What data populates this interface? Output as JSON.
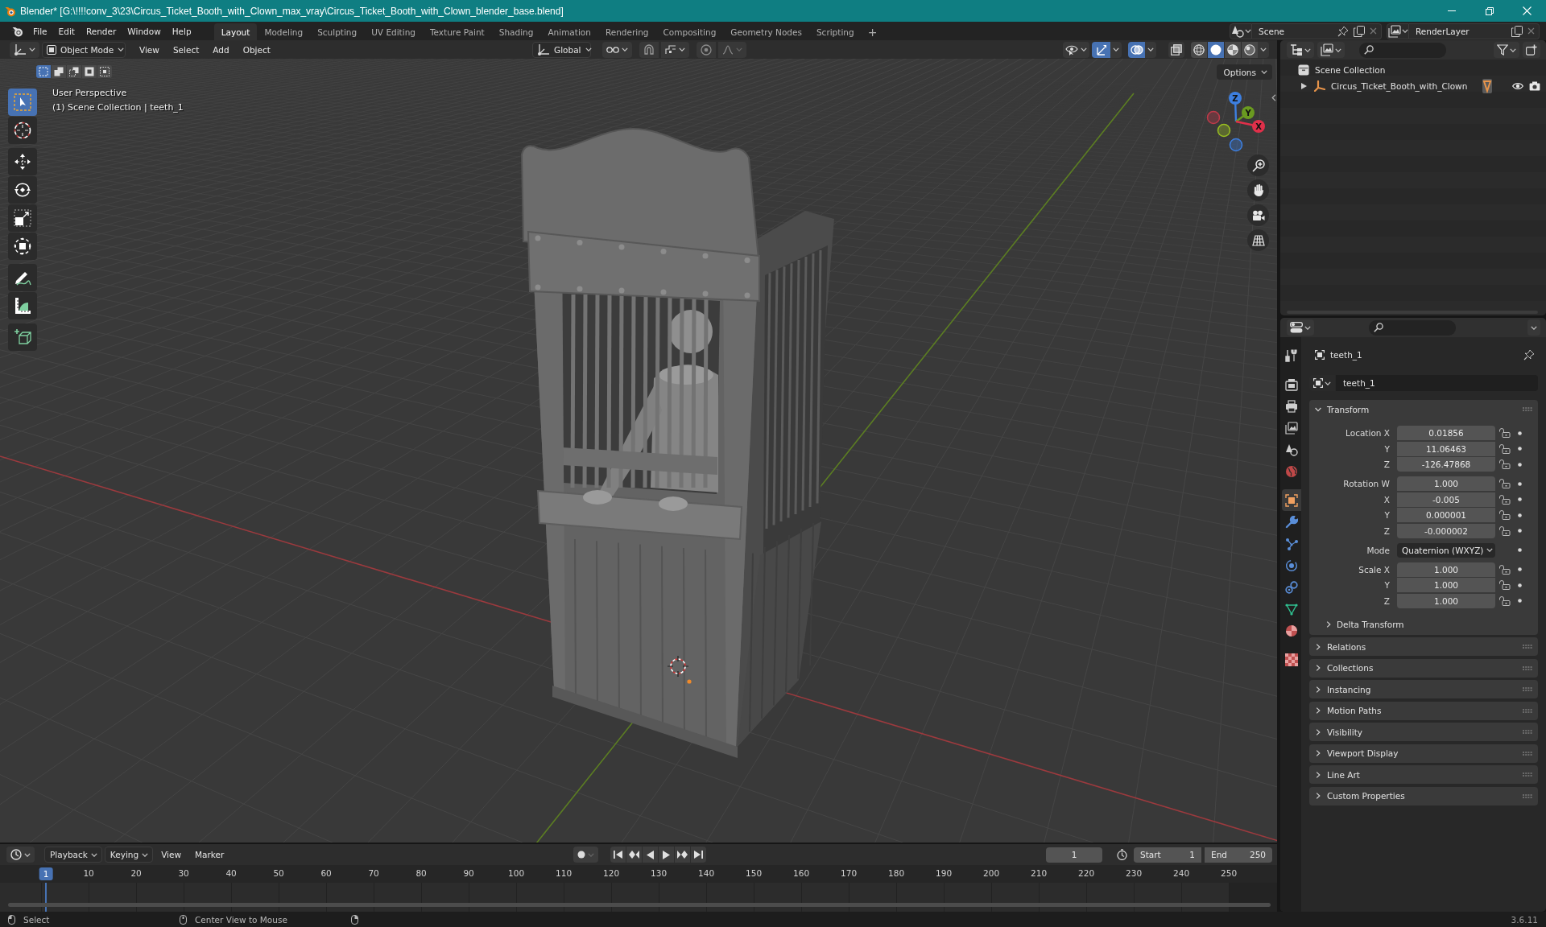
{
  "window": {
    "title": "Blender* [G:\\!!!!conv_3\\23\\Circus_Ticket_Booth_with_Clown_max_vray\\Circus_Ticket_Booth_with_Clown_blender_base.blend]"
  },
  "top_bar": {
    "menus": [
      "File",
      "Edit",
      "Render",
      "Window",
      "Help"
    ],
    "workspaces": [
      {
        "label": "Layout",
        "selected": true
      },
      {
        "label": "Modeling",
        "selected": false
      },
      {
        "label": "Sculpting",
        "selected": false
      },
      {
        "label": "UV Editing",
        "selected": false
      },
      {
        "label": "Texture Paint",
        "selected": false
      },
      {
        "label": "Shading",
        "selected": false
      },
      {
        "label": "Animation",
        "selected": false
      },
      {
        "label": "Rendering",
        "selected": false
      },
      {
        "label": "Compositing",
        "selected": false
      },
      {
        "label": "Geometry Nodes",
        "selected": false
      },
      {
        "label": "Scripting",
        "selected": false
      }
    ],
    "add_workspace": "+",
    "scene": "Scene",
    "view_layer": "RenderLayer"
  },
  "viewport": {
    "header": {
      "mode": "Object Mode",
      "menus": [
        "View",
        "Select",
        "Add",
        "Object"
      ],
      "orientation": "Global",
      "snap": {
        "on": false
      },
      "proportional": {
        "on": false
      },
      "gizmos": {
        "on": true
      },
      "overlays": {
        "on": true
      },
      "xray": {
        "on": false
      },
      "shading": [
        {
          "selected": false
        },
        {
          "selected": true
        },
        {
          "selected": false
        },
        {
          "selected": false
        }
      ]
    },
    "select_modes": [
      {
        "selected": true
      },
      {
        "selected": false
      },
      {
        "selected": false
      },
      {
        "selected": false
      },
      {
        "selected": false
      }
    ],
    "tool_groups": [
      [
        {
          "selected": true
        },
        {
          "selected": false
        }
      ],
      [
        {
          "selected": false
        },
        {
          "selected": false
        },
        {
          "selected": false
        },
        {
          "selected": false
        }
      ],
      [
        {
          "selected": false
        },
        {
          "selected": false
        }
      ],
      [
        {
          "selected": false
        }
      ]
    ],
    "overlay_text": [
      "User Perspective",
      "(1) Scene Collection | teeth_1"
    ],
    "options": "Options",
    "axis_labels": [
      "Z",
      "Y",
      "X"
    ]
  },
  "timeline": {
    "menus": [
      {
        "label": "Playback",
        "kind": "dropdown"
      },
      {
        "label": "Keying",
        "kind": "dropdown"
      },
      {
        "label": "View",
        "kind": "menu"
      },
      {
        "label": "Marker",
        "kind": "menu"
      }
    ],
    "frame": "1",
    "start": {
      "label": "Start",
      "value": "1"
    },
    "end": {
      "label": "End",
      "value": "250"
    },
    "playhead": "1",
    "ruler": [
      "10",
      "20",
      "30",
      "40",
      "50",
      "60",
      "70",
      "80",
      "90",
      "100",
      "110",
      "120",
      "130",
      "140",
      "150",
      "160",
      "170",
      "180",
      "190",
      "200",
      "210",
      "220",
      "230",
      "240",
      "250"
    ]
  },
  "outliner": {
    "scene_collection": {
      "label": "Scene Collection",
      "children": [
        {
          "label": "Circus_Ticket_Booth_with_Clown",
          "expanded": false,
          "visible": true
        }
      ]
    }
  },
  "properties": {
    "tab_groups": [
      [
        {
          "selected": false
        }
      ],
      [
        {
          "selected": false
        },
        {
          "selected": false
        },
        {
          "selected": false
        },
        {
          "selected": false
        },
        {
          "selected": false
        }
      ],
      [
        {
          "selected": true
        },
        {
          "selected": false
        },
        {
          "selected": false
        },
        {
          "selected": false
        },
        {
          "selected": false
        },
        {
          "selected": false
        },
        {
          "selected": false
        }
      ],
      [
        {
          "selected": false
        }
      ]
    ],
    "object_name": "teeth_1",
    "data_name": "teeth_1",
    "panels": [
      {
        "label": "Transform",
        "expanded": true,
        "groups": [
          {
            "kind": "vector",
            "rows": [
              {
                "label": "Location X",
                "value": "0.01856"
              },
              {
                "label": "Y",
                "value": "11.06463"
              },
              {
                "label": "Z",
                "value": "-126.47868"
              }
            ]
          },
          {
            "kind": "vector",
            "rows": [
              {
                "label": "Rotation W",
                "value": "1.000"
              },
              {
                "label": "X",
                "value": "-0.005"
              },
              {
                "label": "Y",
                "value": "0.000001"
              },
              {
                "label": "Z",
                "value": "-0.000002"
              }
            ]
          },
          {
            "kind": "dropdown",
            "label": "Mode",
            "value": "Quaternion (WXYZ)"
          },
          {
            "kind": "vector",
            "rows": [
              {
                "label": "Scale X",
                "value": "1.000"
              },
              {
                "label": "Y",
                "value": "1.000"
              },
              {
                "label": "Z",
                "value": "1.000"
              }
            ]
          }
        ],
        "subpanels": [
          {
            "label": "Delta Transform",
            "expanded": false
          }
        ]
      },
      {
        "label": "Relations",
        "expanded": false
      },
      {
        "label": "Collections",
        "expanded": false
      },
      {
        "label": "Instancing",
        "expanded": false
      },
      {
        "label": "Motion Paths",
        "expanded": false
      },
      {
        "label": "Visibility",
        "expanded": false
      },
      {
        "label": "Viewport Display",
        "expanded": false
      },
      {
        "label": "Line Art",
        "expanded": false
      },
      {
        "label": "Custom Properties",
        "expanded": false
      }
    ]
  },
  "status_bar": {
    "hints": [
      "Select",
      "Center View to Mouse"
    ],
    "version": "3.6.11"
  }
}
